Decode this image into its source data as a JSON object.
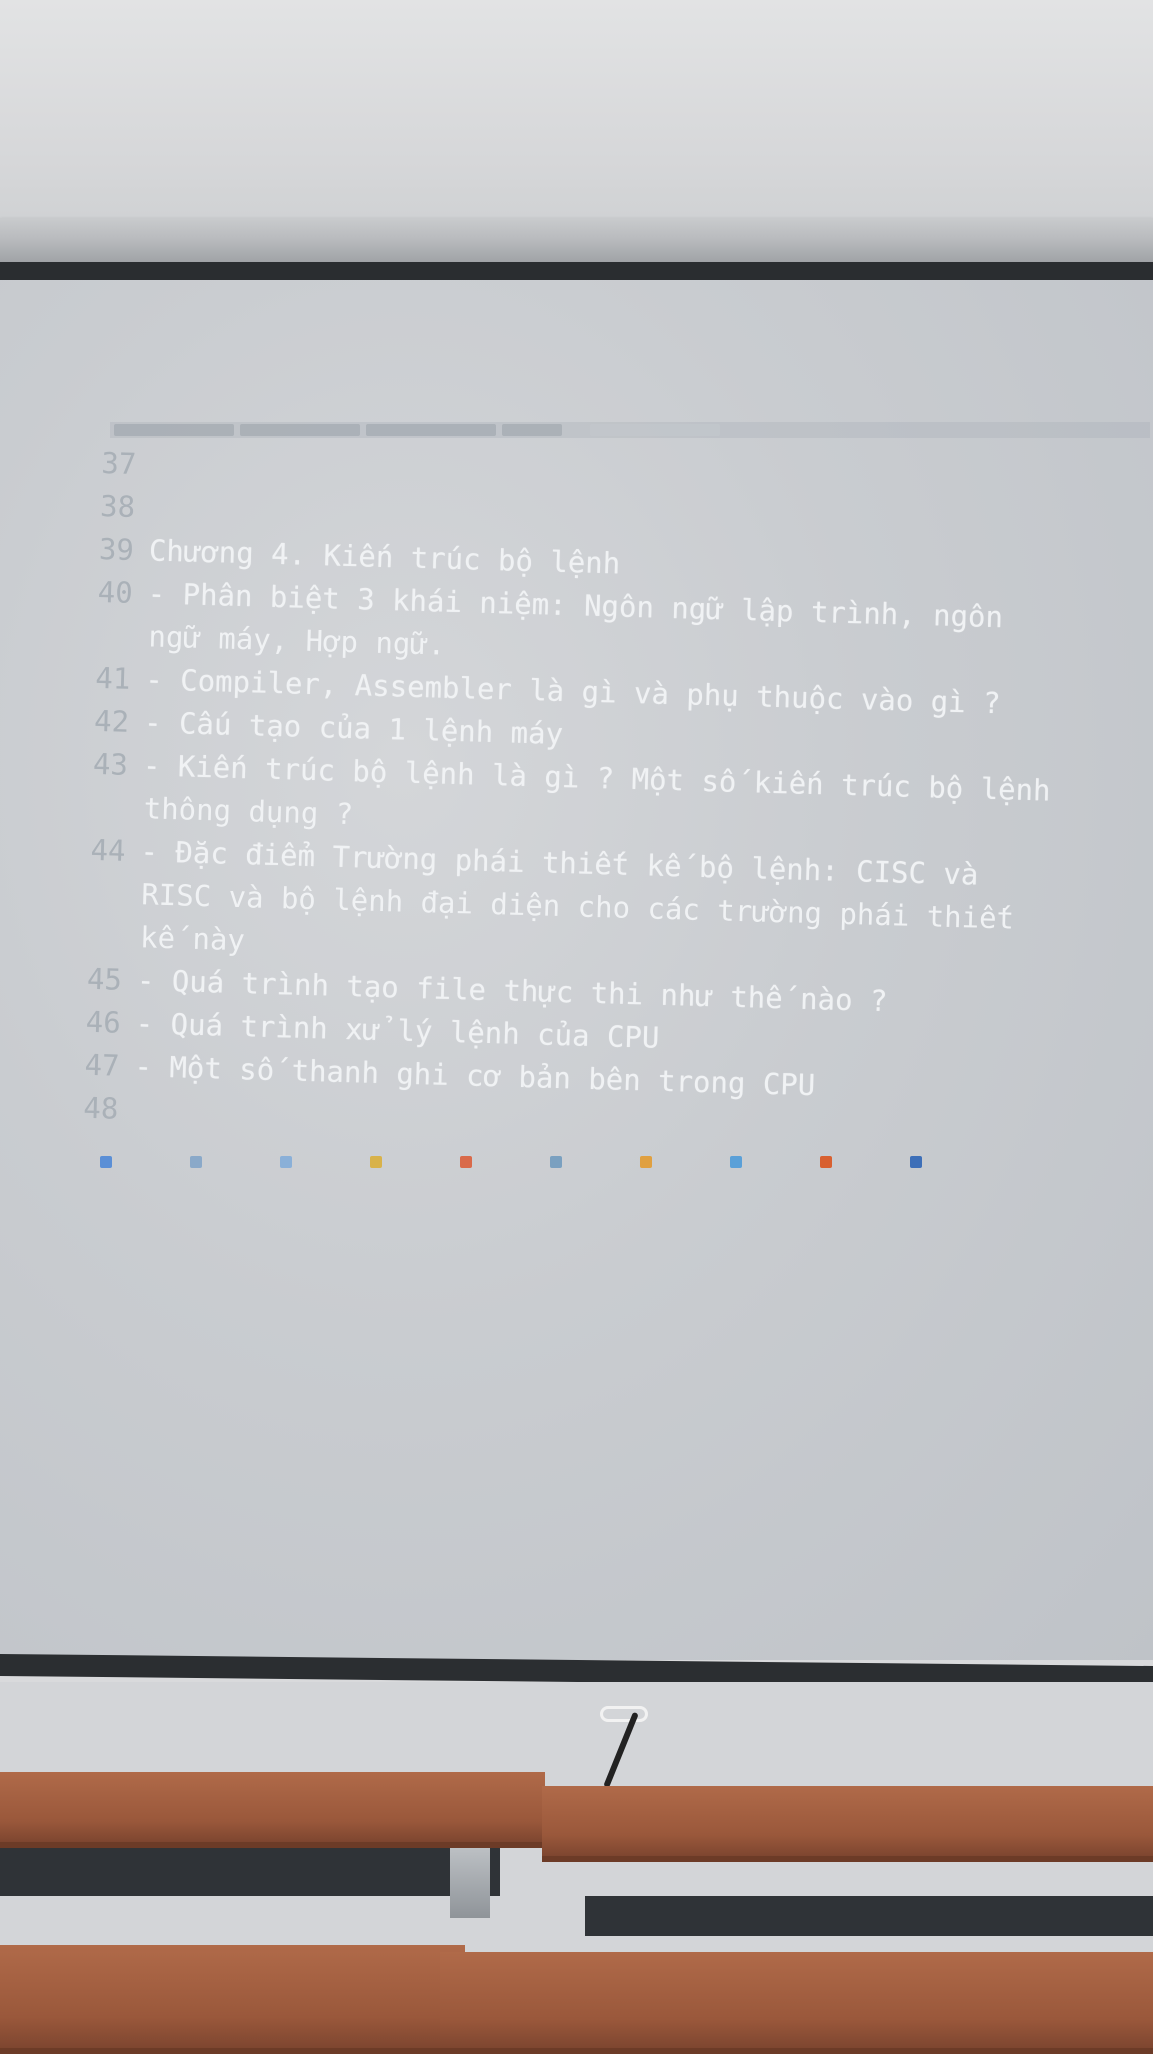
{
  "editor": {
    "title": "",
    "code_lines": [
      {
        "num": "37",
        "text": ""
      },
      {
        "num": "38",
        "text": ""
      },
      {
        "num": "39",
        "text": "Chương 4. Kiến trúc bộ lệnh"
      },
      {
        "num": "40",
        "text": "- Phân biệt 3 khái niệm: Ngôn ngữ lập trình, ngôn",
        "cont": "ngữ máy, Hợp ngữ."
      },
      {
        "num": "41",
        "text": "- Compiler, Assembler là gì và phụ thuộc vào gì ?"
      },
      {
        "num": "42",
        "text": "- Cấu tạo của 1 lệnh máy"
      },
      {
        "num": "43",
        "text": "- Kiến trúc bộ lệnh là gì ? Một số kiến trúc bộ lệnh",
        "cont": "thông dụng ?"
      },
      {
        "num": "44",
        "text": "- Đặc điểm Trường phái thiết kế bộ lệnh: CISC và",
        "cont": "RISC và bộ lệnh đại diện cho các trường phái thiết",
        "cont2": "kế này"
      },
      {
        "num": "45",
        "text": "- Quá trình tạo file thực thi như thế nào ?"
      },
      {
        "num": "46",
        "text": "- Quá trình xử lý lệnh của CPU"
      },
      {
        "num": "47",
        "text": "- Một số thanh ghi cơ bản bên trong CPU"
      },
      {
        "num": "48",
        "text": ""
      }
    ]
  },
  "colors": {
    "screen": "#c9ccd0",
    "code_text": "#f0f2f4",
    "line_number": "#aab1b8",
    "desk_wood": "#a5603f"
  },
  "taskbar": {
    "icons": [
      "windows-icon",
      "search-icon",
      "file-explorer-icon",
      "folder-icon",
      "chrome-icon",
      "check-icon",
      "sublime-text-icon",
      "edge-icon",
      "play-icon",
      "word-icon"
    ]
  }
}
